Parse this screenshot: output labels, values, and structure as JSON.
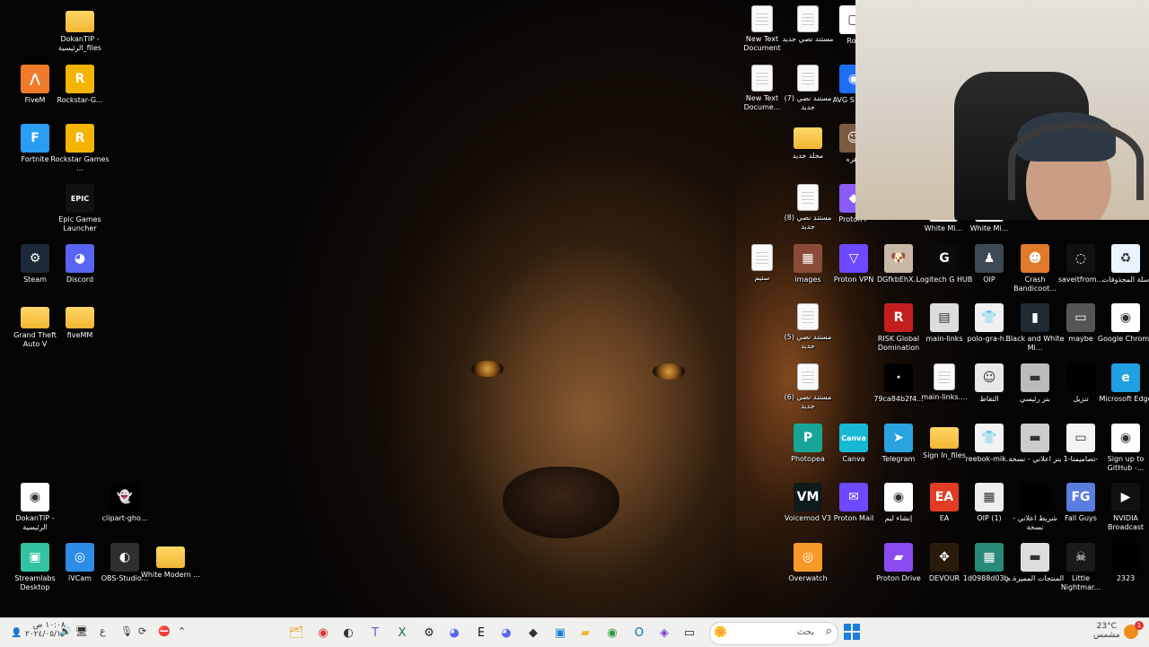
{
  "desktop": {
    "icons": [
      {
        "label": "DokanTIP - الرئيسية_files",
        "type": "folder"
      },
      {
        "label": "FiveM",
        "type": "app",
        "color": "#f07a2a",
        "glyph": "⋀"
      },
      {
        "label": "Rockstar-G...",
        "type": "app",
        "color": "#f4b400",
        "glyph": "R"
      },
      {
        "label": "Fortnite",
        "type": "app",
        "color": "#2a9df4",
        "glyph": "F"
      },
      {
        "label": "Rockstar Games ...",
        "type": "app",
        "color": "#f4b400",
        "glyph": "R"
      },
      {
        "label": "Epic Games Launcher",
        "type": "app",
        "color": "#111111",
        "glyph": "EPIC"
      },
      {
        "label": "Steam",
        "type": "app",
        "color": "#1b2838",
        "glyph": "⚙"
      },
      {
        "label": "Discord",
        "type": "app",
        "color": "#5865f2",
        "glyph": "◕"
      },
      {
        "label": "Grand Theft Auto V",
        "type": "folder"
      },
      {
        "label": "fiveMM",
        "type": "folder"
      },
      {
        "label": "DokanTIP - الرئيسية",
        "type": "app",
        "color": "#ffffff",
        "glyph": "◉"
      },
      {
        "label": "clipart-gho...",
        "type": "app",
        "color": "#000000",
        "glyph": "👻"
      },
      {
        "label": "Streamlabs Desktop",
        "type": "app",
        "color": "#31c3a2",
        "glyph": "▣"
      },
      {
        "label": "iVCam",
        "type": "app",
        "color": "#2d8ce6",
        "glyph": "◎"
      },
      {
        "label": "OBS-Studio...",
        "type": "app",
        "color": "#302e31",
        "glyph": "◐"
      },
      {
        "label": "White Modern ...",
        "type": "folder"
      },
      {
        "label": "New Text Document",
        "type": "doc"
      },
      {
        "label": "مستند نصي جديد",
        "type": "doc"
      },
      {
        "label": "Rob",
        "type": "app",
        "color": "#ffffff",
        "glyph": "▢"
      },
      {
        "label": "New Text Docume...",
        "type": "doc"
      },
      {
        "label": "مستند نصي (7) جديد",
        "type": "doc"
      },
      {
        "label": "AVG S Brow",
        "type": "app",
        "color": "#1d6ef0",
        "glyph": "◉"
      },
      {
        "label": "مجلد جديد",
        "type": "folder"
      },
      {
        "label": "زهره",
        "type": "app",
        "color": "#7a5a40",
        "glyph": "☺"
      },
      {
        "label": "مستند نصي (8) جديد",
        "type": "doc"
      },
      {
        "label": "Proton P",
        "type": "app",
        "color": "#8a5cf5",
        "glyph": "◆"
      },
      {
        "label": "White Mi...",
        "type": "app",
        "color": "#eeeeee",
        "glyph": ""
      },
      {
        "label": "White Mi...",
        "type": "app",
        "color": "#eeeeee",
        "glyph": ""
      },
      {
        "label": "ستيم",
        "type": "doc"
      },
      {
        "label": "images",
        "type": "app",
        "color": "#8a4b3a",
        "glyph": "▦"
      },
      {
        "label": "Proton VPN",
        "type": "app",
        "color": "#6d4aff",
        "glyph": "▽"
      },
      {
        "label": "DGfkbEhX...",
        "type": "app",
        "color": "#c9b8a6",
        "glyph": "🐶"
      },
      {
        "label": "Logitech G HUB",
        "type": "app",
        "color": "#0a0a0a",
        "glyph": "G"
      },
      {
        "label": "OIP",
        "type": "app",
        "color": "#3b4a55",
        "glyph": "♟"
      },
      {
        "label": "Crash Bandicoot...",
        "type": "app",
        "color": "#e07a2a",
        "glyph": "☻"
      },
      {
        "label": "saveitfrom...",
        "type": "app",
        "color": "#111111",
        "glyph": "◌"
      },
      {
        "label": "سلة المحذوفات",
        "type": "app",
        "color": "#eaf4ff",
        "glyph": "♻"
      },
      {
        "label": "مستند نصي (5) جديد",
        "type": "doc"
      },
      {
        "label": "RISK Global Domination",
        "type": "app",
        "color": "#c41f1f",
        "glyph": "R"
      },
      {
        "label": "main-links",
        "type": "app",
        "color": "#dddddd",
        "glyph": "▤"
      },
      {
        "label": "polo-gra-h...",
        "type": "app",
        "color": "#f0f0f0",
        "glyph": "👕"
      },
      {
        "label": "Black and White Mi...",
        "type": "app",
        "color": "#1f2a33",
        "glyph": "▮"
      },
      {
        "label": "maybe",
        "type": "app",
        "color": "#555555",
        "glyph": "▭"
      },
      {
        "label": "Google Chrome",
        "type": "app",
        "color": "#ffffff",
        "glyph": "◉"
      },
      {
        "label": "مستند نصي (6) جديد",
        "type": "doc"
      },
      {
        "label": "79ca84b2f4...",
        "type": "app",
        "color": "#000000",
        "glyph": "·"
      },
      {
        "label": "main-links....",
        "type": "doc"
      },
      {
        "label": "التقاط",
        "type": "app",
        "color": "#e8e8e8",
        "glyph": "☺"
      },
      {
        "label": "بنر رئيسي",
        "type": "app",
        "color": "#bbbbbb",
        "glyph": "▬"
      },
      {
        "label": "تنزيل",
        "type": "app",
        "color": "#000000",
        "glyph": ""
      },
      {
        "label": "Microsoft Edge",
        "type": "app",
        "color": "#1fa0e0",
        "glyph": "e"
      },
      {
        "label": "Photopea",
        "type": "app",
        "color": "#18a497",
        "glyph": "P"
      },
      {
        "label": "Canva",
        "type": "app",
        "color": "#18b8d4",
        "glyph": "Canva"
      },
      {
        "label": "Telegram",
        "type": "app",
        "color": "#2aa3e0",
        "glyph": "➤"
      },
      {
        "label": "Sign In_files",
        "type": "folder"
      },
      {
        "label": "reebok-mik...",
        "type": "app",
        "color": "#f2f2f2",
        "glyph": "👕"
      },
      {
        "label": "بنر اعلاني - نسخة",
        "type": "app",
        "color": "#cccccc",
        "glyph": "▬"
      },
      {
        "label": "تصاميمنا-1-",
        "type": "app",
        "color": "#f4f4f4",
        "glyph": "▭"
      },
      {
        "label": "Sign up to GitHub -...",
        "type": "app",
        "color": "#ffffff",
        "glyph": "◉"
      },
      {
        "label": "Voicemod V3",
        "type": "app",
        "color": "#0f1a1a",
        "glyph": "VM"
      },
      {
        "label": "Proton Mail",
        "type": "app",
        "color": "#6d4aff",
        "glyph": "✉"
      },
      {
        "label": "إنشاء ليم",
        "type": "app",
        "color": "#ffffff",
        "glyph": "◉"
      },
      {
        "label": "EA",
        "type": "app",
        "color": "#e23c24",
        "glyph": "EA"
      },
      {
        "label": "OIP (1)",
        "type": "app",
        "color": "#eeeeee",
        "glyph": "▦"
      },
      {
        "label": "شريط اعلاني - نسخة",
        "type": "app",
        "color": "#000000",
        "glyph": ""
      },
      {
        "label": "Fall Guys",
        "type": "app",
        "color": "#5a7de0",
        "glyph": "FG"
      },
      {
        "label": "NVIDIA Broadcast",
        "type": "app",
        "color": "#111111",
        "glyph": "▶"
      },
      {
        "label": "Overwatch",
        "type": "app",
        "color": "#f89a2a",
        "glyph": "◎"
      },
      {
        "label": "Proton Drive",
        "type": "app",
        "color": "#8a4cf0",
        "glyph": "▰"
      },
      {
        "label": "DEVOUR",
        "type": "app",
        "color": "#2a1a0a",
        "glyph": "✥"
      },
      {
        "label": "1d0988d03b...",
        "type": "app",
        "color": "#2a8a7a",
        "glyph": "▦"
      },
      {
        "label": "المنتجات المميزة م",
        "type": "app",
        "color": "#dddddd",
        "glyph": "▬"
      },
      {
        "label": "Little Nightmar...",
        "type": "app",
        "color": "#1a1a1a",
        "glyph": "☠"
      },
      {
        "label": "2323",
        "type": "app",
        "color": "#000000",
        "glyph": ""
      }
    ]
  },
  "webcam": {
    "label": "webcam overlay"
  },
  "taskbar": {
    "search_placeholder": "بحث",
    "time": "١٠:٠٨ ص",
    "date": "٢٠٢٤/٠٥/١٠",
    "weather_temp": "23°C",
    "weather_text": "مشمس",
    "lang": "ع",
    "notification_count": "1",
    "apps": [
      "file-explorer",
      "chrome",
      "obs",
      "teams",
      "excel",
      "steam",
      "discord-purple",
      "epic",
      "discord",
      "unity",
      "store",
      "explorer-folder",
      "chrome2",
      "outlook",
      "proton",
      "terminal"
    ]
  }
}
